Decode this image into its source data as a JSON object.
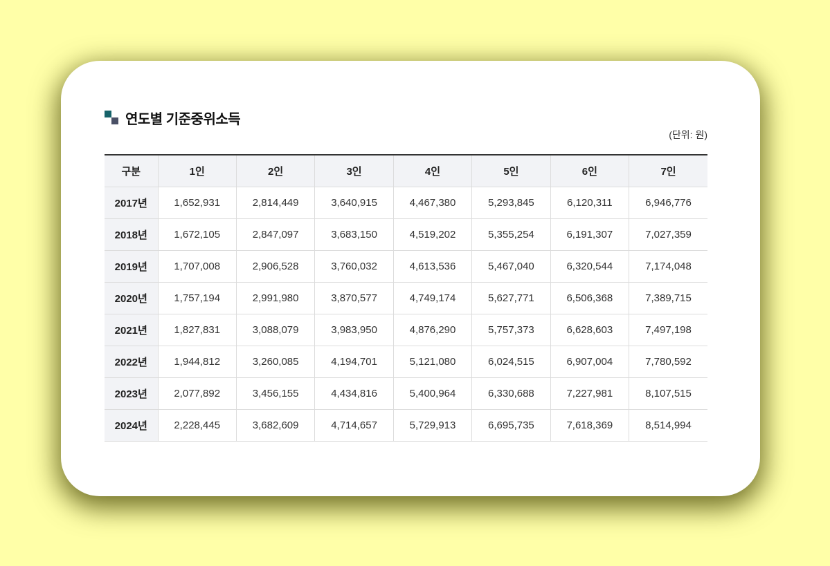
{
  "title": "연도별 기준중위소득",
  "unit": "(단위: 원)",
  "table": {
    "headers": [
      "구분",
      "1인",
      "2인",
      "3인",
      "4인",
      "5인",
      "6인",
      "7인"
    ],
    "rows": [
      {
        "year": "2017년",
        "values": [
          "1,652,931",
          "2,814,449",
          "3,640,915",
          "4,467,380",
          "5,293,845",
          "6,120,311",
          "6,946,776"
        ]
      },
      {
        "year": "2018년",
        "values": [
          "1,672,105",
          "2,847,097",
          "3,683,150",
          "4,519,202",
          "5,355,254",
          "6,191,307",
          "7,027,359"
        ]
      },
      {
        "year": "2019년",
        "values": [
          "1,707,008",
          "2,906,528",
          "3,760,032",
          "4,613,536",
          "5,467,040",
          "6,320,544",
          "7,174,048"
        ]
      },
      {
        "year": "2020년",
        "values": [
          "1,757,194",
          "2,991,980",
          "3,870,577",
          "4,749,174",
          "5,627,771",
          "6,506,368",
          "7,389,715"
        ]
      },
      {
        "year": "2021년",
        "values": [
          "1,827,831",
          "3,088,079",
          "3,983,950",
          "4,876,290",
          "5,757,373",
          "6,628,603",
          "7,497,198"
        ]
      },
      {
        "year": "2022년",
        "values": [
          "1,944,812",
          "3,260,085",
          "4,194,701",
          "5,121,080",
          "6,024,515",
          "6,907,004",
          "7,780,592"
        ]
      },
      {
        "year": "2023년",
        "values": [
          "2,077,892",
          "3,456,155",
          "4,434,816",
          "5,400,964",
          "6,330,688",
          "7,227,981",
          "8,107,515"
        ]
      },
      {
        "year": "2024년",
        "values": [
          "2,228,445",
          "3,682,609",
          "4,714,657",
          "5,729,913",
          "6,695,735",
          "7,618,369",
          "8,514,994"
        ]
      }
    ]
  }
}
